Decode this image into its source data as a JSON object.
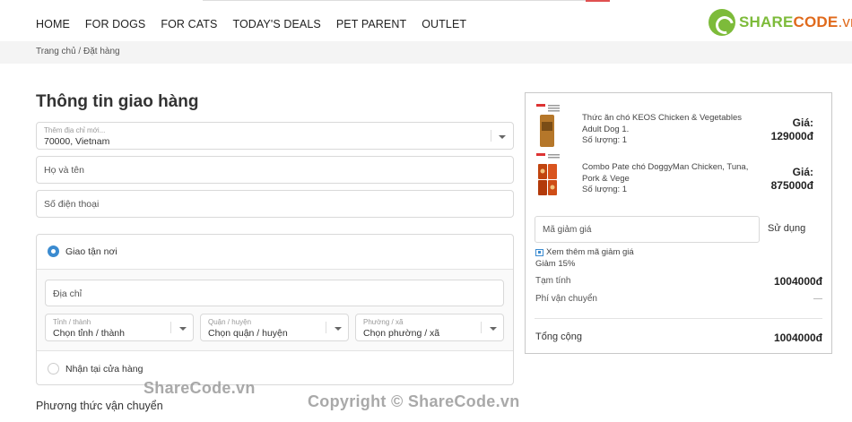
{
  "nav": {
    "items": [
      "HOME",
      "FOR DOGS",
      "FOR CATS",
      "TODAY'S DEALS",
      "PET PARENT",
      "OUTLET"
    ],
    "logo_share": "SHARE",
    "logo_code": "CODE",
    "logo_suffix": ".vn"
  },
  "breadcrumb": "Trang chủ / Đặt hàng",
  "form": {
    "title": "Thông tin giao hàng",
    "address_select": {
      "label": "Thêm địa chỉ mới...",
      "value": "70000, Vietnam"
    },
    "name_placeholder": "Họ và tên",
    "phone_placeholder": "Số điện thoại",
    "delivery_home_label": "Giao tận nơi",
    "address_placeholder": "Địa chỉ",
    "province": {
      "label": "Tỉnh / thành",
      "value": "Chọn tỉnh / thành"
    },
    "district": {
      "label": "Quận / huyện",
      "value": "Chọn quận / huyện"
    },
    "ward": {
      "label": "Phường / xã",
      "value": "Chọn phường / xã"
    },
    "pickup_label": "Nhận tại cửa hàng",
    "shipping_method_title": "Phương thức vận chuyển"
  },
  "summary": {
    "products": [
      {
        "name": "Thức ăn chó KEOS Chicken & Vegetables Adult Dog 1.",
        "qty": "Số lượng: 1",
        "price_label": "Giá:",
        "price": "129000đ"
      },
      {
        "name": "Combo Pate chó DoggyMan Chicken, Tuna, Pork & Vege",
        "qty": "Số lượng: 1",
        "price_label": "Giá:",
        "price": "875000đ"
      }
    ],
    "coupon_placeholder": "Mã giảm giá",
    "coupon_button": "Sử dụng",
    "coupon_more": "Xem thêm mã giảm giá",
    "discount_note": "Giảm 15%",
    "subtotal_label": "Tạm tính",
    "subtotal_value": "1004000đ",
    "shipping_label": "Phí vận chuyển",
    "shipping_value": "—",
    "total_label": "Tổng cộng",
    "total_value": "1004000đ"
  },
  "watermark": {
    "text1": "ShareCode.vn",
    "text2": "Copyright © ShareCode.vn"
  },
  "colors": {
    "radio_accent": "#3b8bd0",
    "logo_green": "#7dbb3a",
    "logo_orange": "#e06a1c"
  }
}
